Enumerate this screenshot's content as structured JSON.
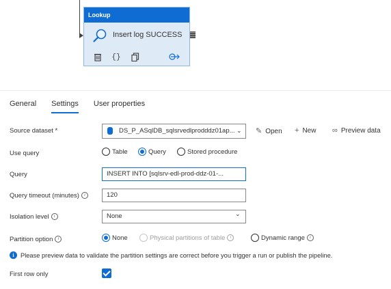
{
  "activity": {
    "type_label": "Lookup",
    "name": "Insert log SUCCESS"
  },
  "tabs": [
    {
      "label": "General"
    },
    {
      "label": "Settings"
    },
    {
      "label": "User properties"
    }
  ],
  "form": {
    "source_dataset": {
      "label": "Source dataset *",
      "value": "DS_P_ASqlDB_sqlsrvedlprodddz01ap...",
      "actions": {
        "open": "Open",
        "new": "New",
        "preview": "Preview data"
      }
    },
    "use_query": {
      "label": "Use query",
      "options": [
        "Table",
        "Query",
        "Stored procedure"
      ],
      "selected": "Query"
    },
    "query": {
      "label": "Query",
      "value": "INSERT INTO [sqlsrv-edl-prod-ddz-01-..."
    },
    "query_timeout": {
      "label": "Query timeout (minutes)",
      "value": "120"
    },
    "isolation_level": {
      "label": "Isolation level",
      "value": "None"
    },
    "partition_option": {
      "label": "Partition option",
      "options": [
        "None",
        "Physical partitions of table",
        "Dynamic range"
      ],
      "selected": "None"
    },
    "info_message": "Please preview data to validate the partition settings are correct before you trigger a run or publish the pipeline.",
    "first_row_only": {
      "label": "First row only",
      "checked": true
    }
  },
  "colors": {
    "accent": "#0f6cd3",
    "activity_bg": "#dfeaf7"
  }
}
